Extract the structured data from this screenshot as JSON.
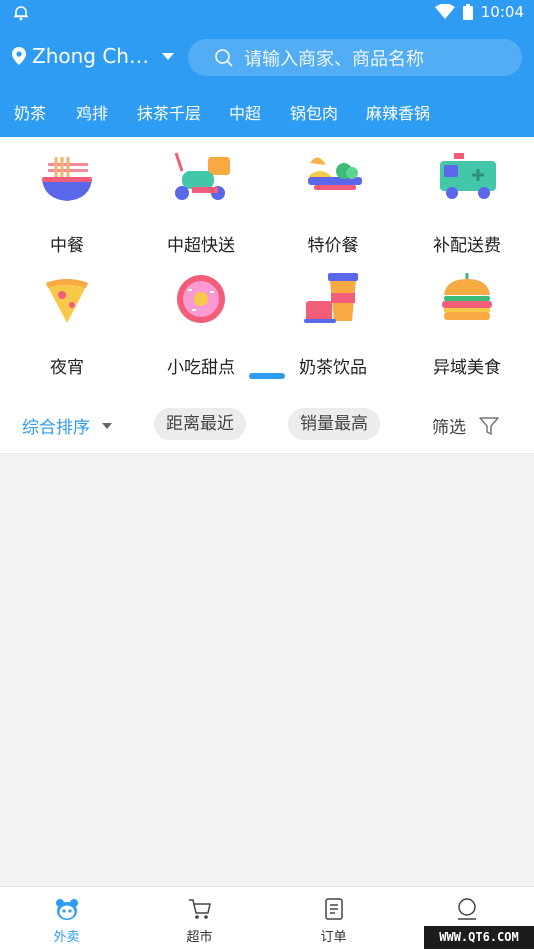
{
  "status": {
    "time": "10:04"
  },
  "header": {
    "location": "Zhong Che...",
    "search_placeholder": "请输入商家、商品名称",
    "hot_tags": [
      "奶茶",
      "鸡排",
      "抹茶千层",
      "中超",
      "锅包肉",
      "麻辣香锅"
    ]
  },
  "categories": [
    {
      "label": "中餐",
      "icon": "noodle-bowl-icon"
    },
    {
      "label": "中超快送",
      "icon": "delivery-scooter-icon"
    },
    {
      "label": "特价餐",
      "icon": "meal-tray-icon"
    },
    {
      "label": "补配送费",
      "icon": "delivery-van-icon"
    },
    {
      "label": "夜宵",
      "icon": "pizza-slice-icon"
    },
    {
      "label": "小吃甜点",
      "icon": "donut-icon"
    },
    {
      "label": "奶茶饮品",
      "icon": "milk-tea-cup-icon"
    },
    {
      "label": "异域美食",
      "icon": "burger-icon"
    }
  ],
  "sort": {
    "main": "综合排序",
    "options": [
      "距离最近",
      "销量最高"
    ],
    "filter": "筛选"
  },
  "tabs": [
    {
      "label": "外卖",
      "icon": "panda-icon",
      "active": true
    },
    {
      "label": "超市",
      "icon": "cart-icon",
      "active": false
    },
    {
      "label": "订单",
      "icon": "order-list-icon",
      "active": false
    },
    {
      "label": "",
      "icon": "profile-icon",
      "active": false
    }
  ],
  "watermark": "WWW.QT6.COM",
  "colors": {
    "primary": "#2d9cf2",
    "background": "#f2f2f2"
  }
}
